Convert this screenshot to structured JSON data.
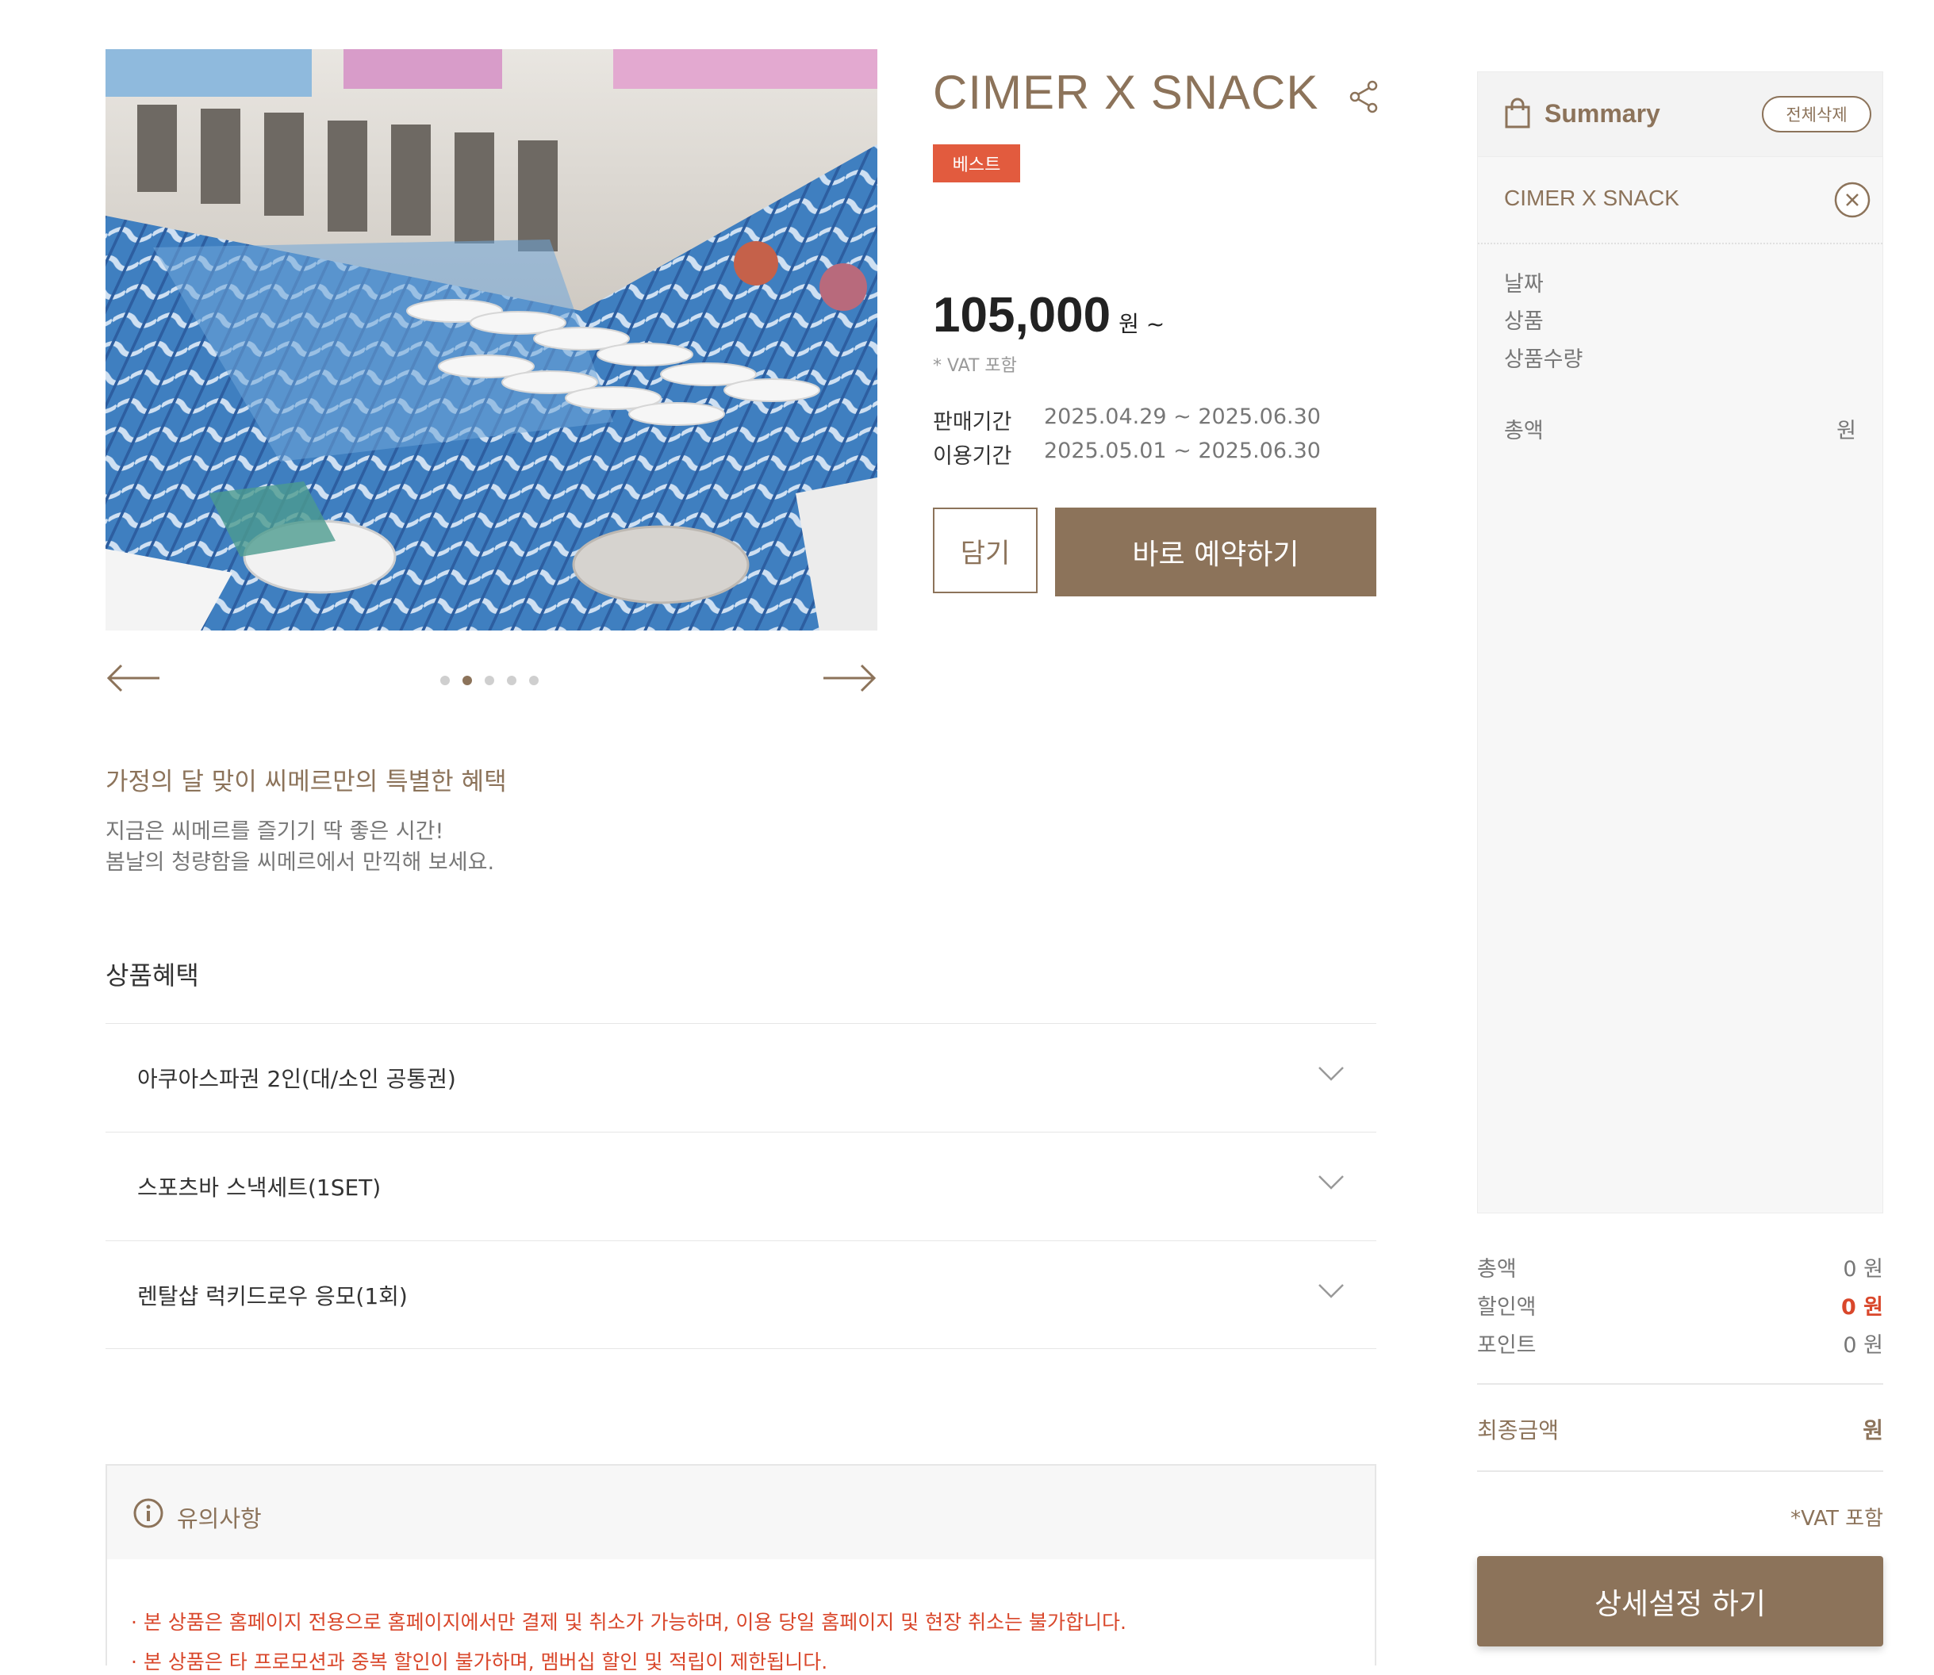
{
  "product": {
    "title": "CIMER X SNACK",
    "badge": "베스트",
    "price": "105,000",
    "price_unit": "원 ~",
    "vat_note": "* VAT 포함",
    "sale_period_label": "판매기간",
    "sale_period_value": "2025.04.29 ~ 2025.06.30",
    "use_period_label": "이용기간",
    "use_period_value": "2025.05.01 ~ 2025.06.30",
    "cart_label": "담기",
    "book_label": "바로 예약하기"
  },
  "gallery": {
    "slide_count": 5,
    "active_index": 1
  },
  "promo": {
    "headline": "가정의 달 맞이 씨메르만의 특별한 혜택",
    "line1": "지금은 씨메르를 즐기기 딱 좋은 시간!",
    "line2": "봄날의 청량함을 씨메르에서 만끽해 보세요."
  },
  "benefits": {
    "title": "상품혜택",
    "items": [
      {
        "label": "아쿠아스파권 2인(대/소인 공통권)"
      },
      {
        "label": "스포츠바 스낵세트(1SET)"
      },
      {
        "label": "렌탈샵 럭키드로우 응모(1회)"
      }
    ]
  },
  "notice": {
    "title": "유의사항",
    "lines": [
      "· 본 상품은 홈페이지 전용으로 홈페이지에서만 결제 및 취소가 가능하며, 이용 당일 홈페이지 및 현장 취소는 불가합니다.",
      "· 본 상품은 타 프로모션과 중복 할인이 불가하며, 멤버십 할인 및 적립이 제한됩니다."
    ]
  },
  "summary": {
    "title": "Summary",
    "clear_all": "전체삭제",
    "item_name": "CIMER X SNACK",
    "field_date": "날짜",
    "field_product": "상품",
    "field_qty": "상품수량",
    "field_total": "총액",
    "field_total_unit": "원",
    "total_label": "총액",
    "total_value": "0 원",
    "discount_label": "할인액",
    "discount_value": "0 원",
    "point_label": "포인트",
    "point_value": "0 원",
    "final_label": "최종금액",
    "final_value": "원",
    "vat": "*VAT 포함",
    "detail_button": "상세설정 하기"
  },
  "colors": {
    "accent": "#8c735a",
    "badge": "#e25b3e",
    "warning": "#d9472b"
  }
}
